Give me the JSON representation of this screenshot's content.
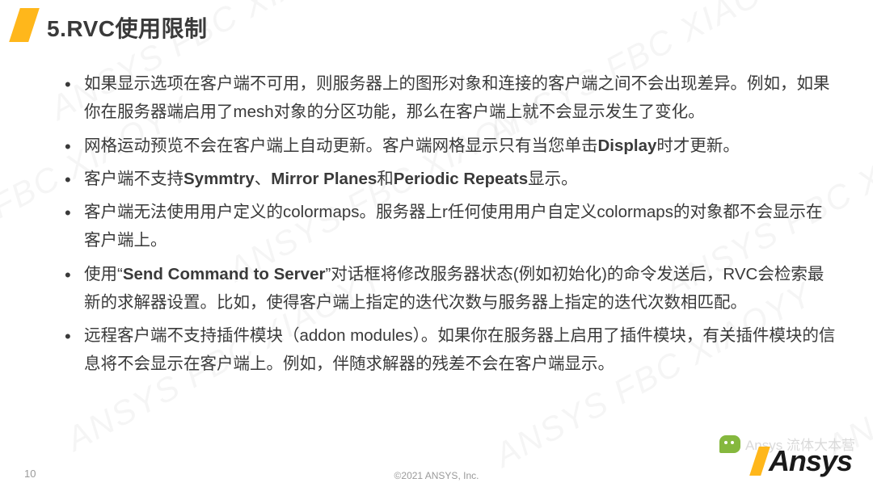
{
  "title": "5.RVC使用限制",
  "bullets": [
    {
      "html": "如果显示选项在客户端不可用，则服务器上的图形对象和连接的客户端之间不会出现差异。例如，如果你在服务器端启用了mesh对象的分区功能，那么在客户端上就不会显示发生了变化。"
    },
    {
      "html": "网格运动预览不会在客户端上自动更新。客户端网格显示只有当您单击<b>Display</b>时才更新。"
    },
    {
      "html": "客户端不支持<b>Symmtry</b>、<b>Mirror Planes</b>和<b>Periodic Repeats</b>显示。"
    },
    {
      "html": "客户端无法使用用户定义的colormaps。服务器上r任何使用用户自定义colormaps的对象都不会显示在客户端上。"
    },
    {
      "html": "使用“<b>Send Command to Server</b>”对话框将修改服务器状态(例如初始化)的命令发送后，RVC会检索最新的求解器设置。比如，使得客户端上指定的迭代次数与服务器上指定的迭代次数相匹配。"
    },
    {
      "html": "远程客户端不支持插件模块（addon modules）。如果你在服务器上启用了插件模块，有关插件模块的信息将不会显示在客户端上。例如，伴随求解器的残差不会在客户端显示。"
    }
  ],
  "page_number": "10",
  "copyright": "©2021 ANSYS, Inc.",
  "logo_text": "Ansys",
  "watermark_text": "ANSYS FBC XIAOYY",
  "overlay_text": "Ansys 流体大本营"
}
